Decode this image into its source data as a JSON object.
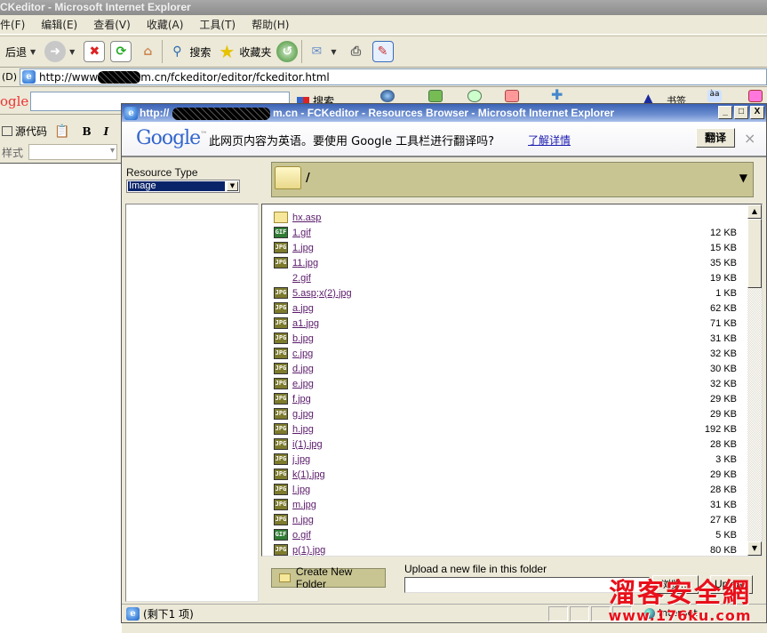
{
  "main_window": {
    "title": "CKeditor - Microsoft Internet Explorer",
    "menu": [
      "件(F)",
      "编辑(E)",
      "查看(V)",
      "收藏(A)",
      "工具(T)",
      "帮助(H)"
    ],
    "toolbar": {
      "back_label": "后退",
      "search_label": "搜索",
      "favorites_label": "收藏夹"
    },
    "address_label": "(D)",
    "address_prefix": "http://www",
    "address_suffix": "m.cn/fckeditor/editor/fckeditor.html",
    "google_logo": "ogle",
    "google_search_label": "搜索",
    "google_extra_label": "书签"
  },
  "editor": {
    "source_label": "源代码",
    "bold_label": "B",
    "italic_label": "I",
    "style_label": "样式"
  },
  "popup": {
    "title_prefix": "http://",
    "title_suffix": "m.cn - FCKeditor - Resources Browser - Microsoft Internet Explorer",
    "window_buttons": {
      "minimize": "_",
      "maximize": "□",
      "close": "X"
    },
    "translate_bar": {
      "logo": "Google",
      "message": "此网页内容为英语。要使用 Google 工具栏进行翻译吗?",
      "link": "了解详情",
      "button": "翻译",
      "close": "×"
    },
    "resource_type_label": "Resource Type",
    "resource_type_value": "Image",
    "current_folder": "/",
    "files": [
      {
        "name": "hx.asp",
        "type": "folder",
        "size": ""
      },
      {
        "name": "1.gif",
        "type": "gif",
        "size": "12 KB"
      },
      {
        "name": "1.jpg",
        "type": "jpg",
        "size": "15 KB"
      },
      {
        "name": "11.jpg",
        "type": "jpg",
        "size": "35 KB"
      },
      {
        "name": "2.gif",
        "type": "none",
        "size": "19 KB"
      },
      {
        "name": "5.asp;x(2).jpg",
        "type": "jpg",
        "size": "1 KB"
      },
      {
        "name": "a.jpg",
        "type": "jpg",
        "size": "62 KB"
      },
      {
        "name": "a1.jpg",
        "type": "jpg",
        "size": "71 KB"
      },
      {
        "name": "b.jpg",
        "type": "jpg",
        "size": "31 KB"
      },
      {
        "name": "c.jpg",
        "type": "jpg",
        "size": "32 KB"
      },
      {
        "name": "d.jpg",
        "type": "jpg",
        "size": "30 KB"
      },
      {
        "name": "e.jpg",
        "type": "jpg",
        "size": "32 KB"
      },
      {
        "name": "f.jpg",
        "type": "jpg",
        "size": "29 KB"
      },
      {
        "name": "g.jpg",
        "type": "jpg",
        "size": "29 KB"
      },
      {
        "name": "h.jpg",
        "type": "jpg",
        "size": "192 KB"
      },
      {
        "name": "i(1).jpg",
        "type": "jpg",
        "size": "28 KB"
      },
      {
        "name": "j.jpg",
        "type": "jpg",
        "size": "3 KB"
      },
      {
        "name": "k(1).jpg",
        "type": "jpg",
        "size": "29 KB"
      },
      {
        "name": "l.jpg",
        "type": "jpg",
        "size": "28 KB"
      },
      {
        "name": "m.jpg",
        "type": "jpg",
        "size": "31 KB"
      },
      {
        "name": "n.jpg",
        "type": "jpg",
        "size": "27 KB"
      },
      {
        "name": "o.gif",
        "type": "gif",
        "size": "5 KB"
      },
      {
        "name": "p(1).jpg",
        "type": "jpg",
        "size": "80 KB"
      }
    ],
    "create_folder_label": "Create New Folder",
    "upload_label": "Upload a new file in this folder",
    "upload_value": "",
    "browse_label": "浏览...",
    "upload_button": "Upload",
    "status_text": "(剩下1 项)",
    "zone_label": "Internet"
  },
  "watermark": {
    "text": "溜客安全網",
    "url": "www.176ku.com",
    "color": "#e8101a"
  }
}
